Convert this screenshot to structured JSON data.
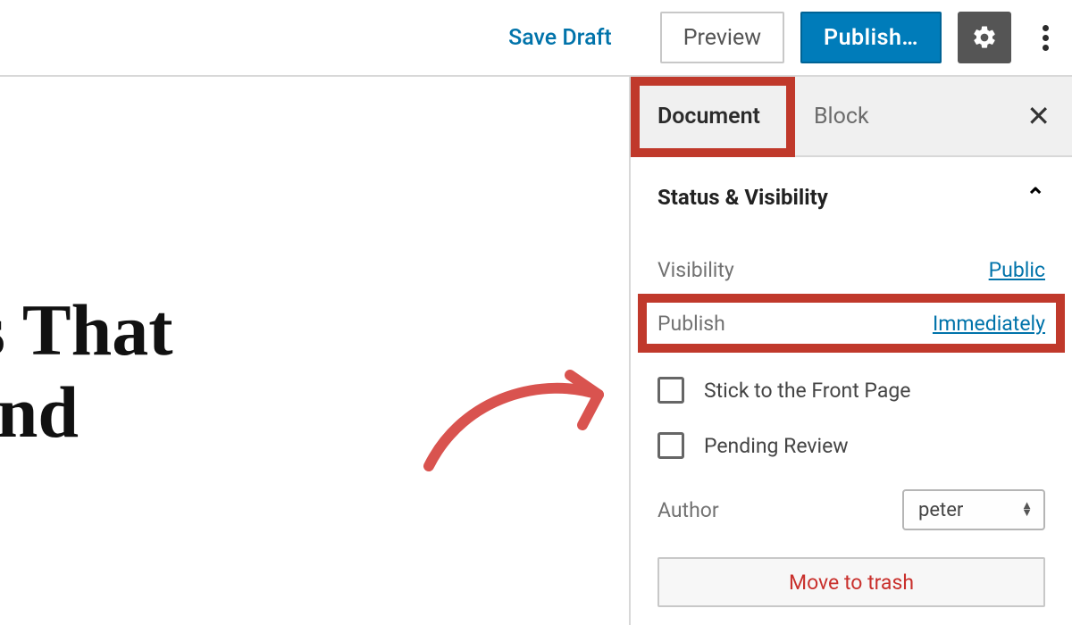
{
  "toolbar": {
    "save_draft": "Save Draft",
    "preview": "Preview",
    "publish": "Publish…"
  },
  "editor": {
    "title_line1": "s That",
    "title_line2": "ind"
  },
  "sidebar": {
    "tabs": {
      "document": "Document",
      "block": "Block"
    },
    "panel_title": "Status & Visibility",
    "rows": {
      "visibility_label": "Visibility",
      "visibility_value": "Public",
      "publish_label": "Publish",
      "publish_value": "Immediately",
      "stick": "Stick to the Front Page",
      "pending": "Pending Review",
      "author_label": "Author",
      "author_value": "peter"
    },
    "trash": "Move to trash"
  },
  "colors": {
    "accent": "#0073aa",
    "highlight": "#c0392b",
    "danger_text": "#c9302c"
  }
}
